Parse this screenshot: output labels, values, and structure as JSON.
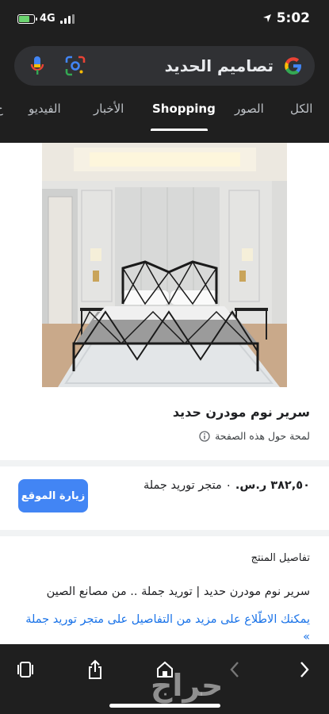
{
  "status_bar": {
    "network": "4G",
    "time": "5:02",
    "battery_level": 0.7
  },
  "search": {
    "query": "تصاميم الحديد"
  },
  "tabs": [
    {
      "label": "الكل",
      "active": false
    },
    {
      "label": "الصور",
      "active": false
    },
    {
      "label": "Shopping",
      "active": true
    },
    {
      "label": "الأخبار",
      "active": false
    },
    {
      "label": "الفيديو",
      "active": false
    },
    {
      "label": "خ",
      "active": false
    }
  ],
  "product": {
    "title": "سرير نوم مودرن حديد",
    "about_link": "لمحة حول هذه الصفحة",
    "price": "٣٨٢,٥٠ ر.س.",
    "seller": "٠ متجر توريد جملة",
    "visit_button": "زيارة الموقع",
    "details_heading": "تفاصيل المنتج",
    "description": "سرير نوم مودرن حديد | توريد جملة .. من مصانع الصين",
    "more_link": "يمكنك الاطّلاع على مزيد من التفاصيل على متجر توريد جملة »"
  },
  "watermark": "حراج",
  "colors": {
    "accent": "#4285f4",
    "link": "#1a73e8",
    "dark_bg": "#1f1f1f",
    "search_bg": "#303134"
  }
}
